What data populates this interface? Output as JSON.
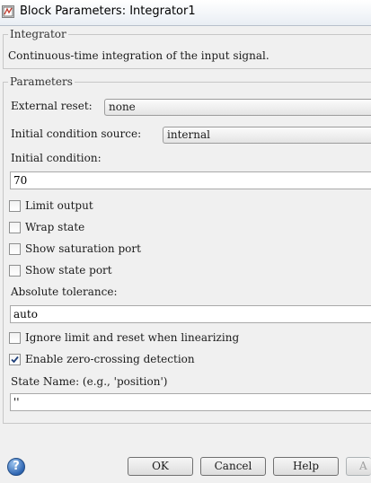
{
  "window": {
    "title": "Block Parameters: Integrator1"
  },
  "block": {
    "legend": "Integrator",
    "description": "Continuous-time integration of the input signal."
  },
  "parameters": {
    "legend": "Parameters",
    "external_reset": {
      "label": "External reset:",
      "value": "none"
    },
    "ic_source": {
      "label": "Initial condition source:",
      "value": "internal"
    },
    "initial_condition": {
      "label": "Initial condition:",
      "value": "70"
    },
    "limit_output": {
      "label": "Limit output",
      "checked": false
    },
    "wrap_state": {
      "label": "Wrap state",
      "checked": false
    },
    "show_saturation_port": {
      "label": "Show saturation port",
      "checked": false
    },
    "show_state_port": {
      "label": "Show state port",
      "checked": false
    },
    "absolute_tolerance": {
      "label": "Absolute tolerance:",
      "value": "auto"
    },
    "ignore_limit": {
      "label": "Ignore limit and reset when linearizing",
      "checked": false
    },
    "zero_crossing": {
      "label": "Enable zero-crossing detection",
      "checked": true
    },
    "state_name": {
      "label": "State Name: (e.g., 'position')",
      "value": "''"
    }
  },
  "buttons": {
    "ok": "OK",
    "cancel": "Cancel",
    "help": "Help",
    "apply_partial": "A"
  },
  "icons": {
    "title": "simulink-block-icon",
    "help": "question-mark-icon"
  }
}
